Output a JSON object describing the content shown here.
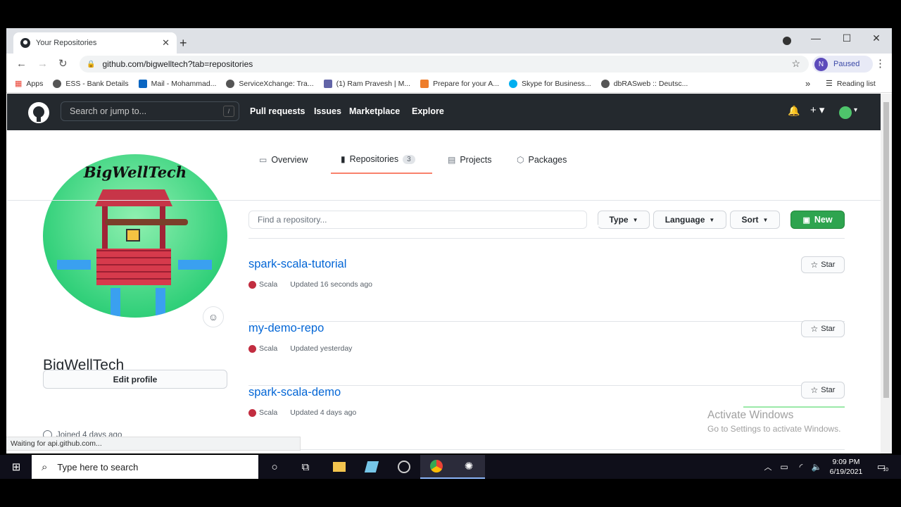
{
  "browser": {
    "tab_title": "Your Repositories",
    "url": "github.com/bigwelltech?tab=repositories",
    "profile_initial": "N",
    "profile_status": "Paused",
    "bookmarks": [
      {
        "label": "Apps",
        "color": "#ea4335"
      },
      {
        "label": "ESS - Bank Details",
        "color": "#555"
      },
      {
        "label": "Mail - Mohammad...",
        "color": "#0a66c2"
      },
      {
        "label": "ServiceXchange: Tra...",
        "color": "#555"
      },
      {
        "label": "(1) Ram Pravesh | M...",
        "color": "#6264a7"
      },
      {
        "label": "Prepare for your A...",
        "color": "#ee7d2a"
      },
      {
        "label": "Skype for Business...",
        "color": "#00aff0"
      },
      {
        "label": "dbRASweb :: Deutsc...",
        "color": "#555"
      }
    ],
    "more_bookmarks": "»",
    "reading_list": "Reading list",
    "status_text": "Waiting for api.github.com..."
  },
  "github_header": {
    "search_placeholder": "Search or jump to...",
    "search_shortcut": "/",
    "nav": [
      "Pull requests",
      "Issues",
      "Marketplace",
      "Explore"
    ]
  },
  "profile": {
    "avatar_text": "BigWellTech",
    "full_name": "BigWellTech",
    "username": "bigwelltech",
    "edit_label": "Edit profile",
    "joined": "Joined 4 days ago"
  },
  "tabs": [
    {
      "label": "Overview",
      "icon": "book-icon"
    },
    {
      "label": "Repositories",
      "icon": "repo-icon",
      "count": "3",
      "active": true
    },
    {
      "label": "Projects",
      "icon": "project-icon"
    },
    {
      "label": "Packages",
      "icon": "package-icon"
    }
  ],
  "filters": {
    "find_placeholder": "Find a repository...",
    "type_label": "Type",
    "language_label": "Language",
    "sort_label": "Sort",
    "new_label": "New"
  },
  "repos": [
    {
      "name": "spark-scala-tutorial",
      "language": "Scala",
      "lang_color": "#c22d40",
      "updated": "Updated 16 seconds ago",
      "star_label": "Star"
    },
    {
      "name": "my-demo-repo",
      "language": "Scala",
      "lang_color": "#c22d40",
      "updated": "Updated yesterday",
      "star_label": "Star"
    },
    {
      "name": "spark-scala-demo",
      "language": "Scala",
      "lang_color": "#c22d40",
      "updated": "Updated 4 days ago",
      "star_label": "Star"
    }
  ],
  "watermark": {
    "line1": "Activate Windows",
    "line2": "Go to Settings to activate Windows."
  },
  "taskbar": {
    "search_placeholder": "Type here to search",
    "time": "9:09 PM",
    "date": "6/19/2021",
    "notifications": "10"
  }
}
